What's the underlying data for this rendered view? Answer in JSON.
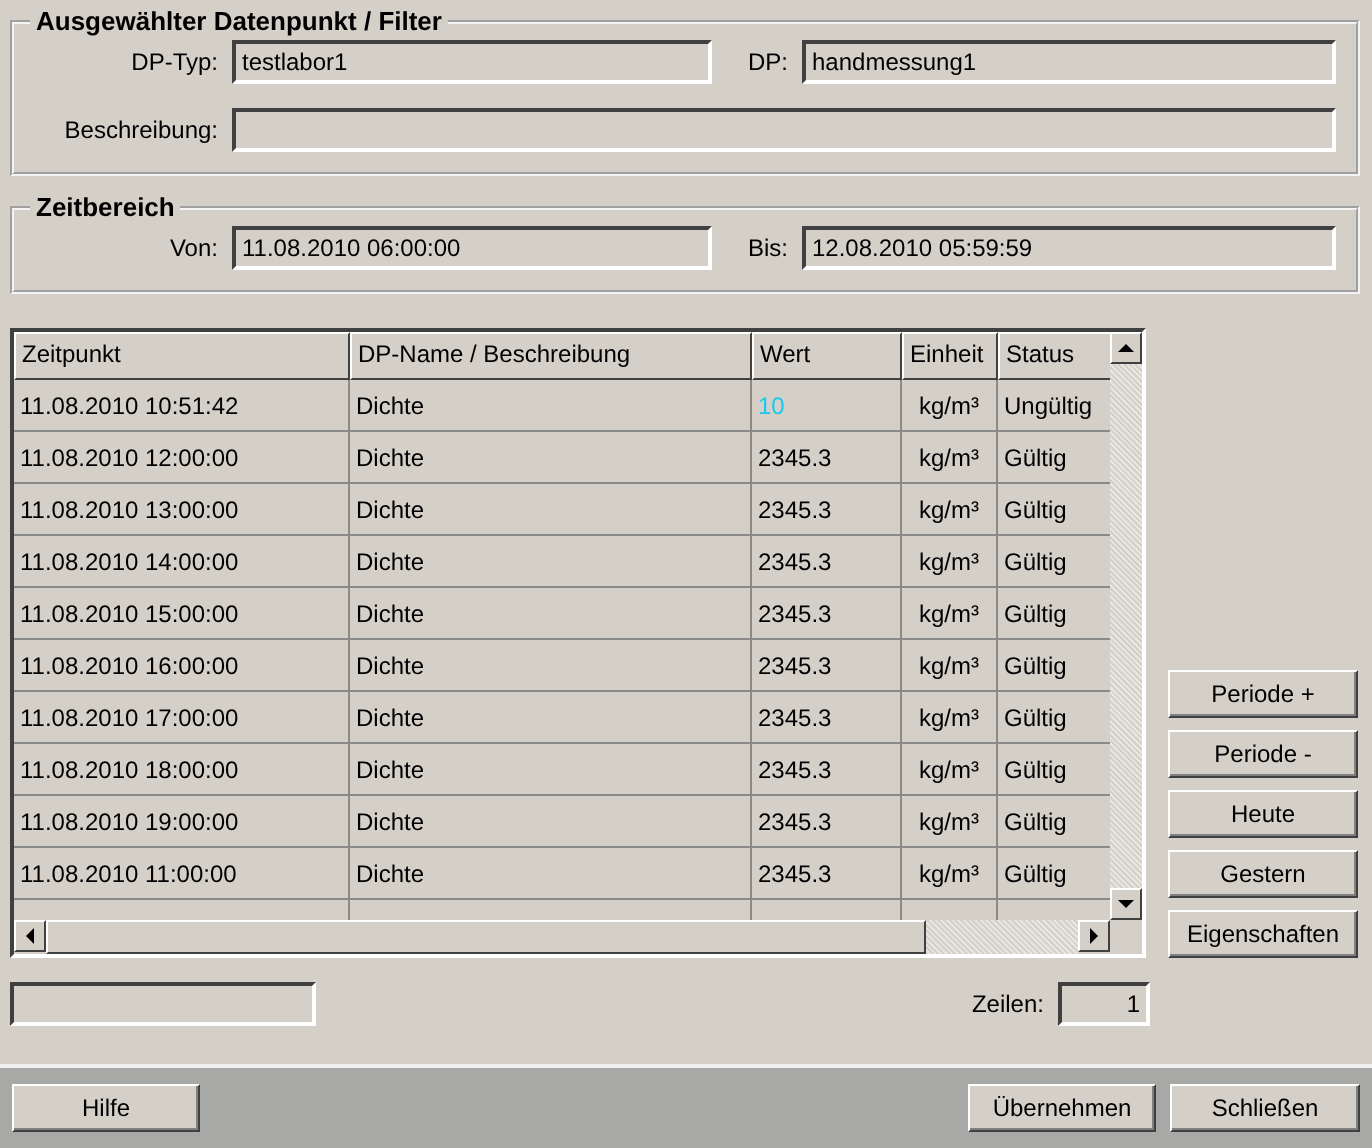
{
  "filter": {
    "title": "Ausgewählter Datenpunkt / Filter",
    "dp_typ_label": "DP-Typ:",
    "dp_typ": "testlabor1",
    "dp_label": "DP:",
    "dp": "handmessung1",
    "beschreibung_label": "Beschreibung:"
  },
  "zeitbereich": {
    "title": "Zeitbereich",
    "von_label": "Von:",
    "von": "11.08.2010 06:00:00",
    "bis_label": "Bis:",
    "bis": "12.08.2010 05:59:59"
  },
  "table": {
    "columns": [
      "Zeitpunkt",
      "DP-Name / Beschreibung",
      "Wert",
      "Einheit",
      "Status"
    ],
    "rows": [
      {
        "cells": [
          "11.08.2010 10:51:42",
          "Dichte",
          "10",
          "kg/m³",
          "Ungültig"
        ],
        "highlighted": true
      },
      {
        "cells": [
          "11.08.2010 12:00:00",
          "Dichte",
          "2345.3",
          "kg/m³",
          "Gültig"
        ],
        "highlighted": false
      },
      {
        "cells": [
          "11.08.2010 13:00:00",
          "Dichte",
          "2345.3",
          "kg/m³",
          "Gültig"
        ],
        "highlighted": false
      },
      {
        "cells": [
          "11.08.2010 14:00:00",
          "Dichte",
          "2345.3",
          "kg/m³",
          "Gültig"
        ],
        "highlighted": false
      },
      {
        "cells": [
          "11.08.2010 15:00:00",
          "Dichte",
          "2345.3",
          "kg/m³",
          "Gültig"
        ],
        "highlighted": false
      },
      {
        "cells": [
          "11.08.2010 16:00:00",
          "Dichte",
          "2345.3",
          "kg/m³",
          "Gültig"
        ],
        "highlighted": false
      },
      {
        "cells": [
          "11.08.2010 17:00:00",
          "Dichte",
          "2345.3",
          "kg/m³",
          "Gültig"
        ],
        "highlighted": false
      },
      {
        "cells": [
          "11.08.2010 18:00:00",
          "Dichte",
          "2345.3",
          "kg/m³",
          "Gültig"
        ],
        "highlighted": false
      },
      {
        "cells": [
          "11.08.2010 19:00:00",
          "Dichte",
          "2345.3",
          "kg/m³",
          "Gültig"
        ],
        "highlighted": false
      },
      {
        "cells": [
          "11.08.2010 11:00:00",
          "Dichte",
          "2345.3",
          "kg/m³",
          "Gültig"
        ],
        "highlighted": false
      }
    ]
  },
  "side_buttons": [
    "Periode +",
    "Periode -",
    "Heute",
    "Gestern",
    "Eigenschaften"
  ],
  "zeilen_label": "Zeilen:",
  "zeilen": "1",
  "footer_buttons": {
    "help": "Hilfe",
    "apply": "Übernehmen",
    "close": "Schließen"
  }
}
